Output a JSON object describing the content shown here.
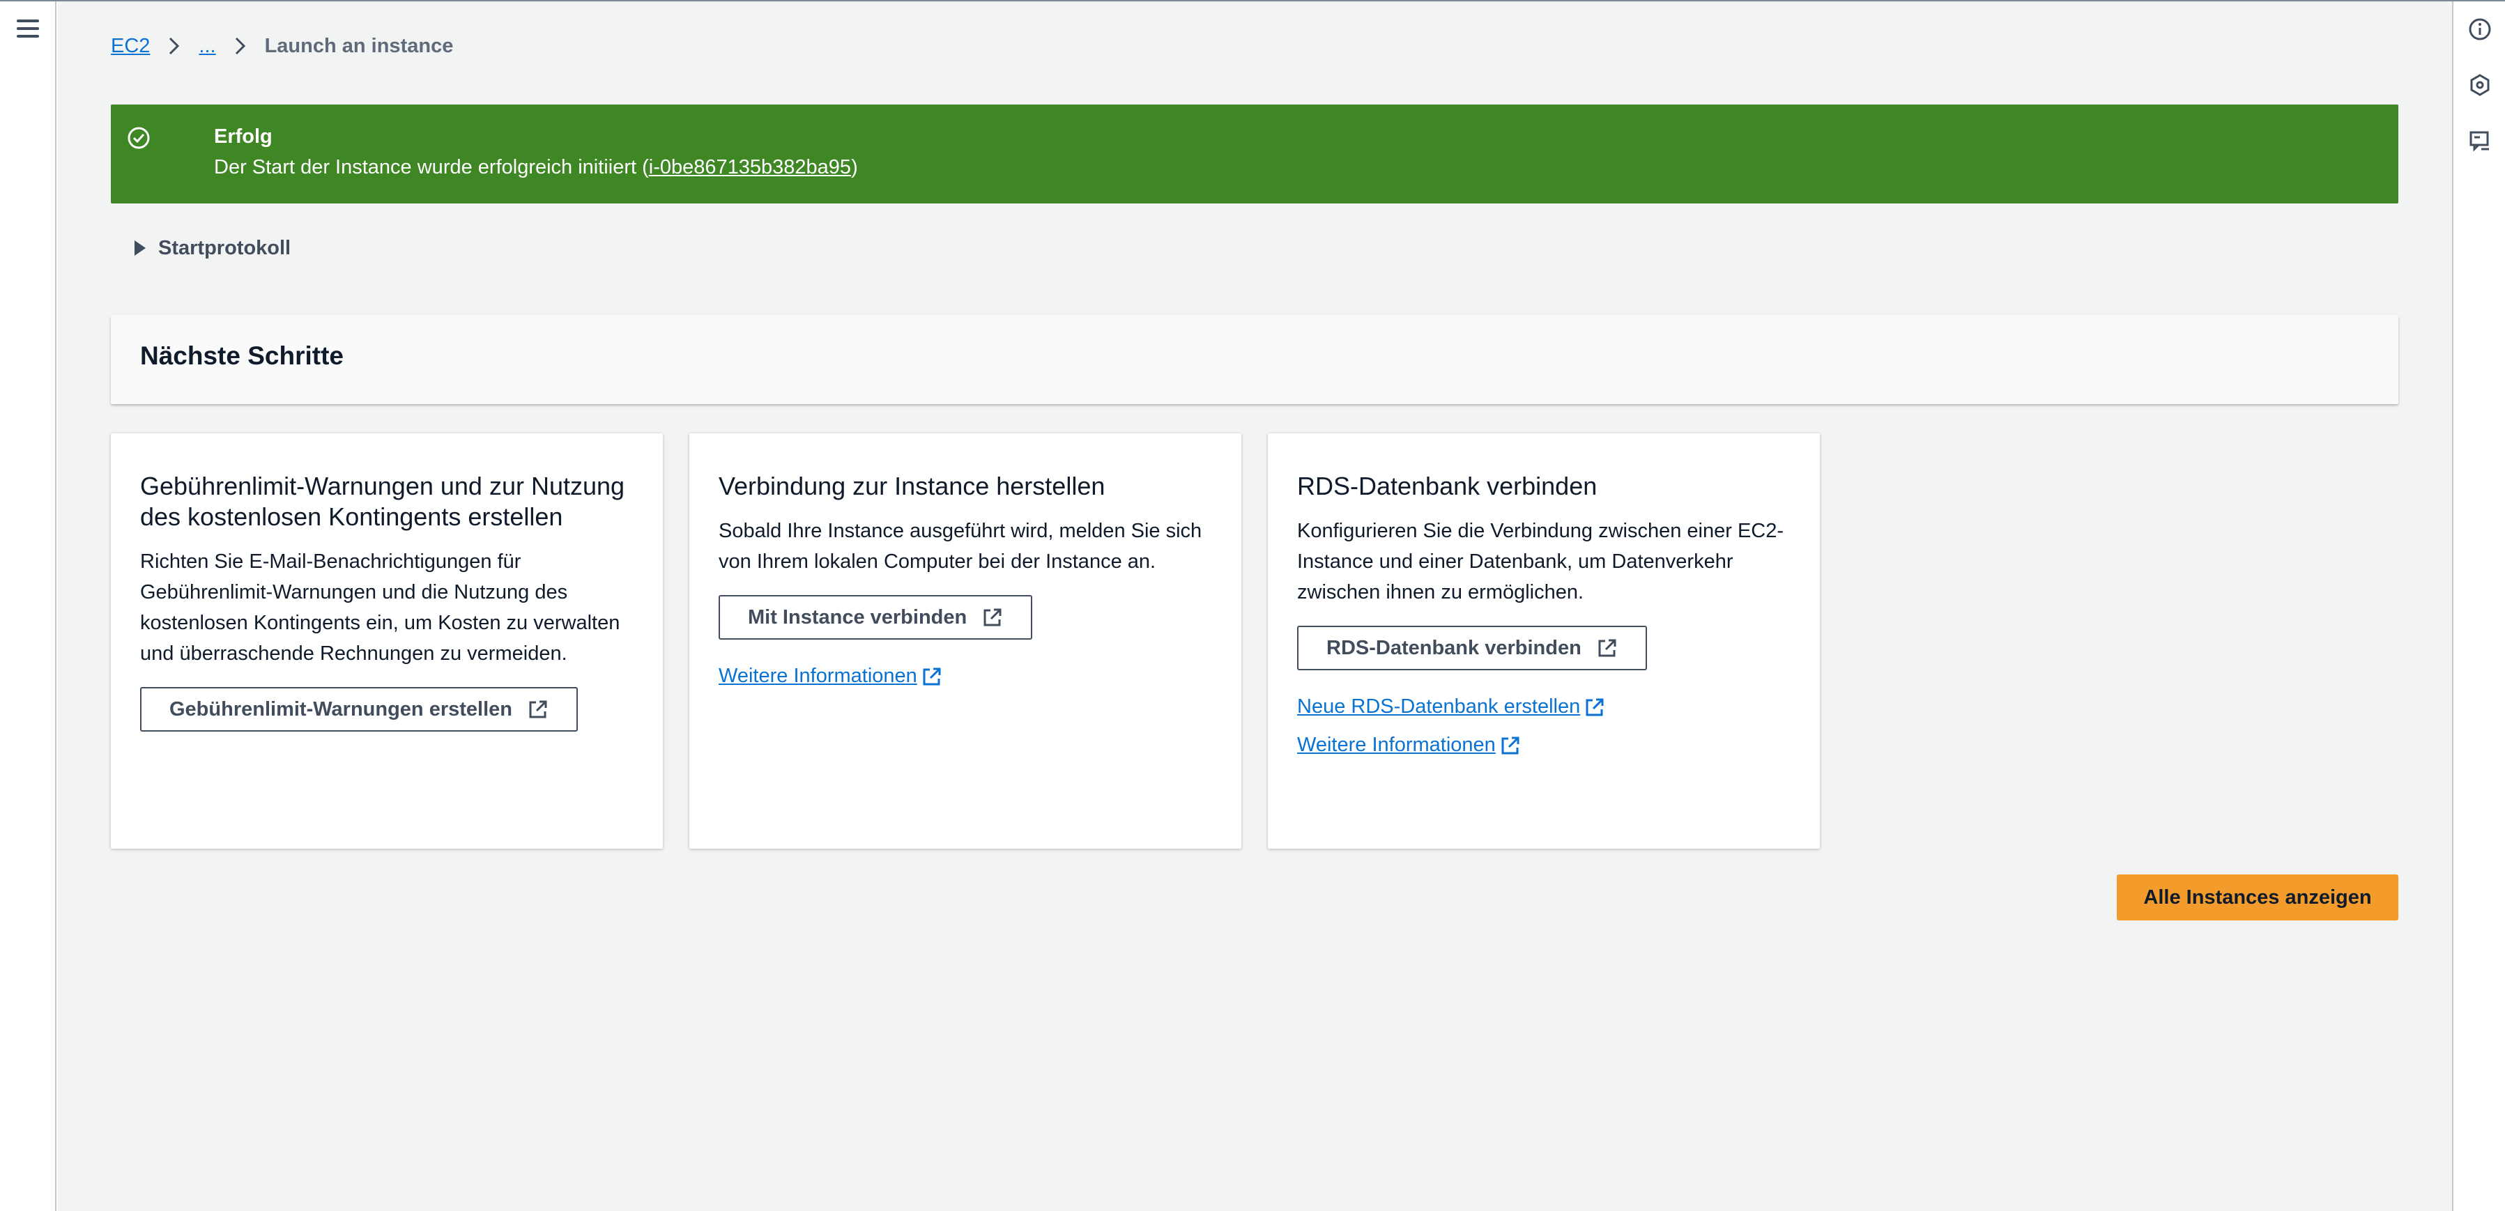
{
  "breadcrumb": {
    "items": [
      "EC2",
      "..."
    ],
    "current": "Launch an instance"
  },
  "flash": {
    "type": "success",
    "color": "#3f8624",
    "title": "Erfolg",
    "message_prefix": "Der Start der Instance wurde erfolgreich initiiert (",
    "instance_id": "i-0be867135b382ba95",
    "message_suffix": ")"
  },
  "expander": {
    "label": "Startprotokoll",
    "expanded": false
  },
  "next_steps": {
    "title": "Nächste Schritte",
    "cards": [
      {
        "title": "Gebührenlimit-Warnungen und zur Nutzung des kostenlosen Kontingents erstellen",
        "text": "Richten Sie E-Mail-Benachrichtigungen für Gebührenlimit-Warnungen und die Nutzung des kostenlosen Kontingents ein, um Kosten zu verwalten und überraschende Rechnungen zu vermeiden.",
        "button": "Gebührenlimit-Warnungen erstellen"
      },
      {
        "title": "Verbindung zur Instance herstellen",
        "text": "Sobald Ihre Instance ausgeführt wird, melden Sie sich von Ihrem lokalen Computer bei der Instance an.",
        "button": "Mit Instance verbinden",
        "links": [
          "Weitere Informationen"
        ]
      },
      {
        "title": "RDS-Datenbank verbinden",
        "text": "Konfigurieren Sie die Verbindung zwischen einer EC2-Instance und einer Datenbank, um Datenverkehr zwischen ihnen zu ermöglichen.",
        "button": "RDS-Datenbank verbinden",
        "links": [
          "Neue RDS-Datenbank erstellen",
          "Weitere Informationen"
        ]
      }
    ]
  },
  "primary_action": {
    "label": "Alle Instances anzeigen",
    "color": "#f39c2c"
  },
  "icons": {
    "left_rail": [
      "hamburger-menu-icon"
    ],
    "right_rail": [
      "info-icon",
      "settings-hex-icon",
      "feedback-icon"
    ],
    "external": "external-link-icon"
  }
}
